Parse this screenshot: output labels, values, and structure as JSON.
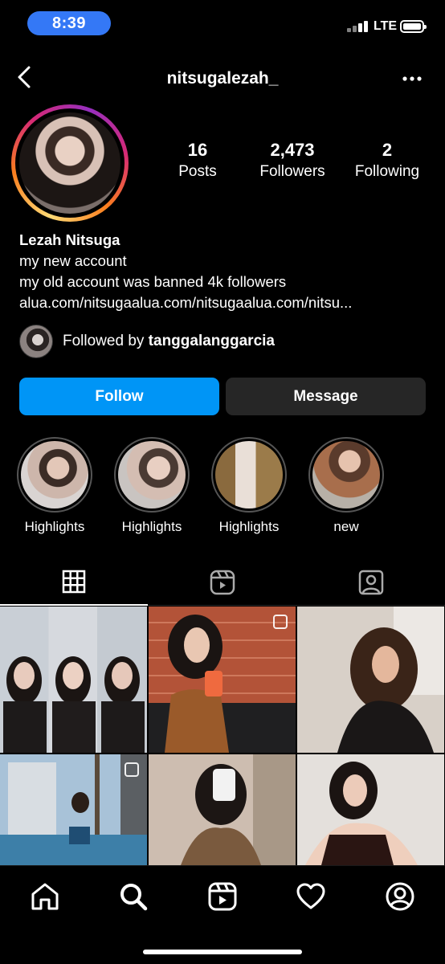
{
  "status_bar": {
    "time": "8:39",
    "network": "LTE",
    "time_pill_color": "#3478f6"
  },
  "header": {
    "username": "nitsugalezah_",
    "back_icon": "chevron-left-icon",
    "more_icon": "ellipsis-icon"
  },
  "profile": {
    "stats": [
      {
        "value": "16",
        "label": "Posts"
      },
      {
        "value": "2,473",
        "label": "Followers"
      },
      {
        "value": "2",
        "label": "Following"
      }
    ],
    "name": "Lezah Nitsuga",
    "bio_lines": [
      "my new account",
      "my old account was banned 4k followers"
    ],
    "link": "alua.com/nitsugaalua.com/nitsugaalua.com/nitsu...",
    "followed_by_prefix": "Followed by",
    "followed_by_user": "tanggalanggarcia"
  },
  "actions": {
    "follow_label": "Follow",
    "message_label": "Message",
    "follow_color": "#0095f6",
    "message_color": "#262626"
  },
  "highlights": [
    {
      "label": "Highlights"
    },
    {
      "label": "Highlights"
    },
    {
      "label": "Highlights"
    },
    {
      "label": "new"
    }
  ],
  "tabs": [
    {
      "icon": "grid-icon",
      "active": true
    },
    {
      "icon": "reels-icon",
      "active": false
    },
    {
      "icon": "tagged-icon",
      "active": false
    }
  ],
  "bottom_nav": [
    {
      "icon": "home-icon"
    },
    {
      "icon": "search-icon"
    },
    {
      "icon": "reels-icon"
    },
    {
      "icon": "heart-icon"
    },
    {
      "icon": "profile-icon"
    }
  ],
  "colors": {
    "background": "#000000",
    "divider": "#262626"
  }
}
